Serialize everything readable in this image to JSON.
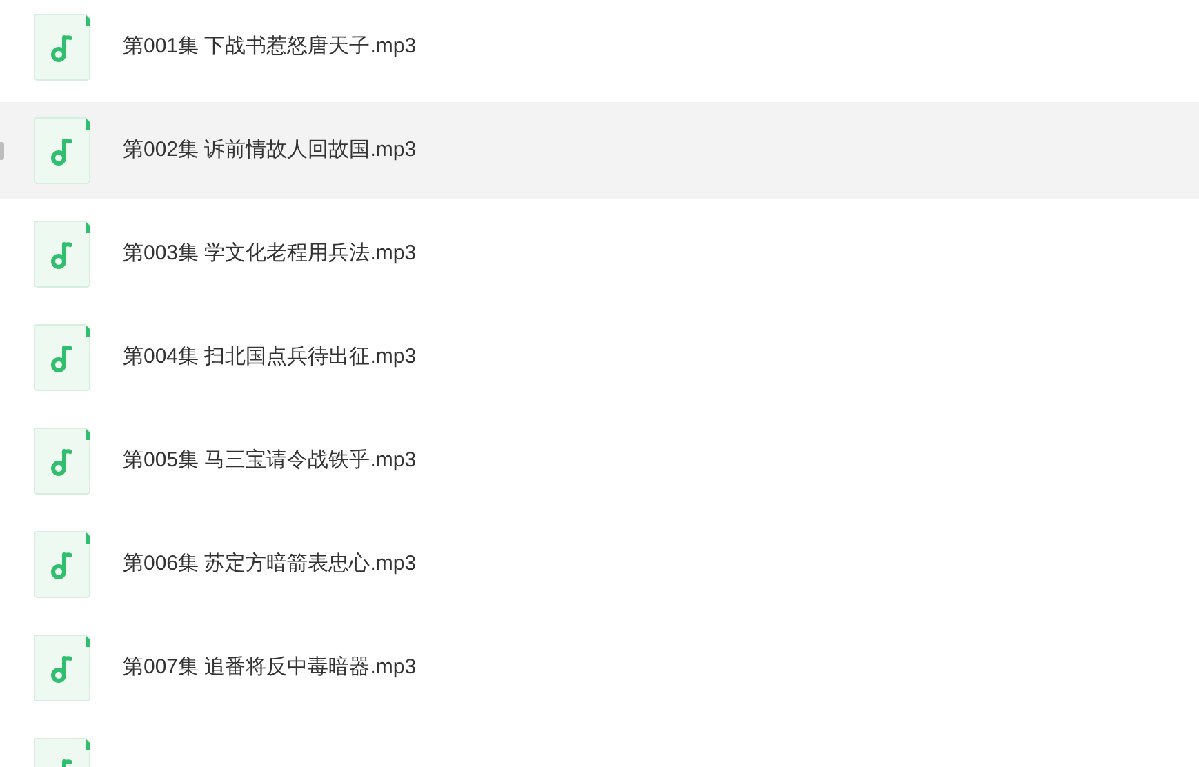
{
  "files": [
    {
      "name": "第001集 下战书惹怒唐天子.mp3",
      "selected": false
    },
    {
      "name": "第002集 诉前情故人回故国.mp3",
      "selected": true
    },
    {
      "name": "第003集 学文化老程用兵法.mp3",
      "selected": false
    },
    {
      "name": "第004集 扫北国点兵待出征.mp3",
      "selected": false
    },
    {
      "name": "第005集 马三宝请令战铁乎.mp3",
      "selected": false
    },
    {
      "name": "第006集 苏定方暗箭表忠心.mp3",
      "selected": false
    },
    {
      "name": "第007集 追番将反中毒暗器.mp3",
      "selected": false
    },
    {
      "selected": false
    }
  ]
}
